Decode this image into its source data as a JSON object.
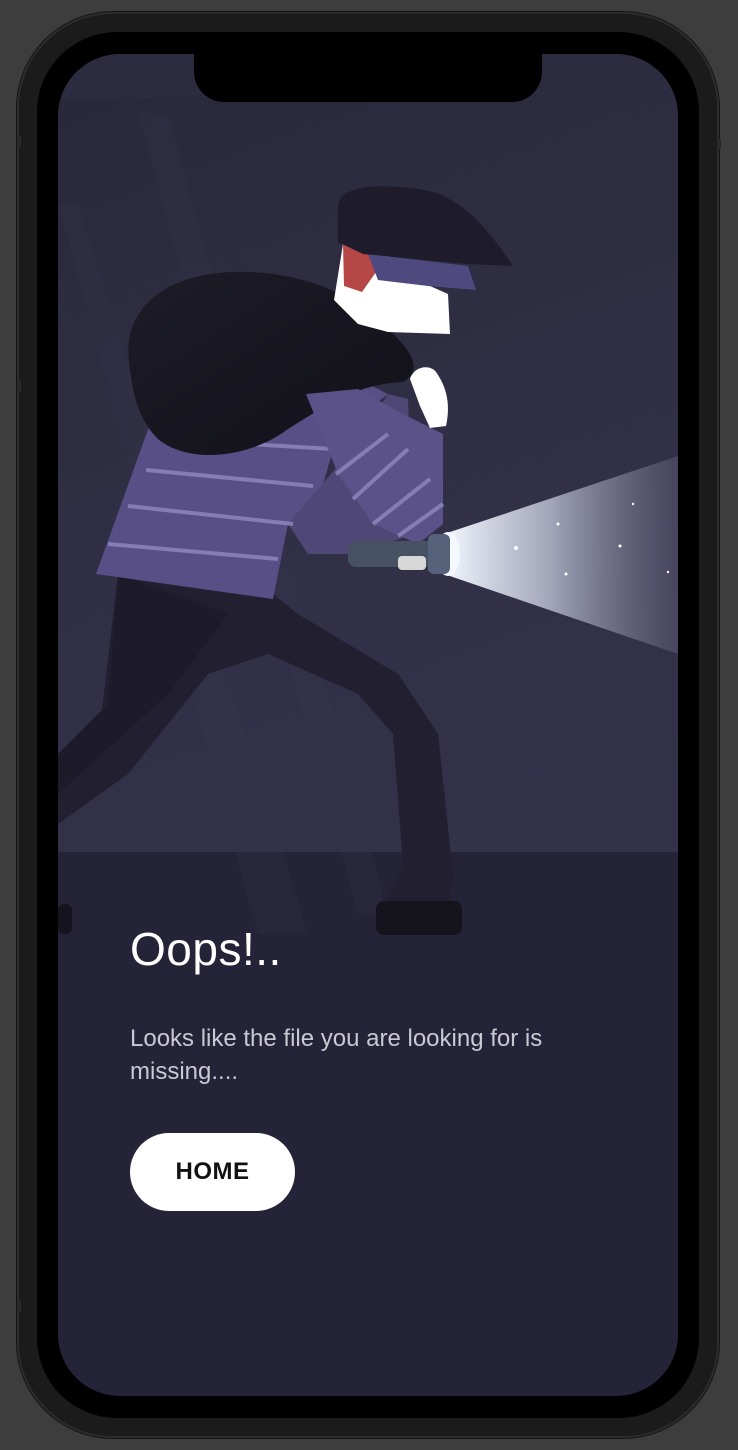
{
  "page": {
    "title": "Oops!..",
    "message": "Looks like the file you are looking for is missing....",
    "home_label": "HOME"
  },
  "illustration": {
    "subject": "burglar-with-flashlight",
    "colors": {
      "background": "#252337",
      "scene": "#313047",
      "sweater": "#574f85",
      "stripes": "#8a82b8",
      "bag": "#17161f",
      "beam": "#eef3ff"
    }
  }
}
